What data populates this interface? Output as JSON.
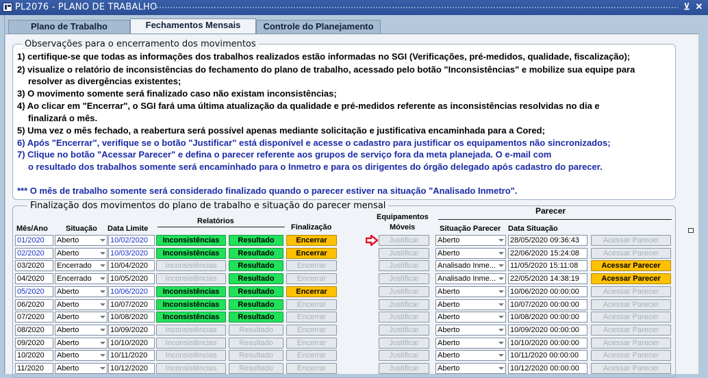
{
  "window": {
    "title": "PL2076 - PLANO DE TRABALHO",
    "restore_symbol": "⊻",
    "close_symbol": "✕"
  },
  "tabs": [
    {
      "label": "Plano de Trabalho",
      "active": false
    },
    {
      "label": "Fechamentos Mensais",
      "active": true
    },
    {
      "label": "Controle do Planejamento",
      "active": false
    }
  ],
  "observations": {
    "title": "Observações para o encerramento dos movimentos",
    "lines": [
      "1) certifique-se que todas as informações dos trabalhos realizados estão informadas no SGI (Verificações, pré-medidos, qualidade, fiscalização);",
      "2) visualize o relatório de inconsistências do fechamento do plano de trabalho, acessado pelo botão \"Inconsistências\" e mobilize sua equipe para",
      "    resolver as divergências existentes;",
      "3) O movimento somente será finalizado caso não existam inconsistências;",
      "4) Ao clicar em \"Encerrar\", o SGI fará uma última atualização da qualidade e pré-medidos referente as inconsistências resolvidas no dia e",
      "    finalizará o mês.",
      "5) Uma vez o mês fechado, a reabertura será possível apenas mediante solicitação e justificativa encaminhada para a Cored;"
    ],
    "blue_lines": [
      " 6) Após \"Encerrar\",  verifique se o botão \"Justificar\" está disponível e acesse o cadastro para justificar os equipamentos não sincronizados;",
      " 7) Clique no botão \"Acessar Parecer\" e defina o parecer referente aos grupos de serviço fora da meta planejada. O e-mail com",
      "     o resultado dos trabalhos somente será encaminhado para o Inmetro e para os dirigentes do órgão delegado após cadastro do parecer.",
      "*** O mês de trabalho somente será considerado finalizado quando o parecer estiver na situação \"Analisado Inmetro\"."
    ]
  },
  "section": {
    "title": "Finalização dos movimentos do plano de trabalho e situação do parecer mensal"
  },
  "headers": {
    "mes_ano": "Mês/Ano",
    "situacao": "Situação",
    "data_limite": "Data Limite",
    "relatorios": "Relatórios",
    "finalizacao": "Finalização",
    "equip_line1": "Equipamentos",
    "equip_line2": "Móveis",
    "parecer": "Parecer",
    "situacao_parecer": "Situação Parecer",
    "data_situacao": "Data Situação"
  },
  "rows": [
    {
      "mes": "01/2020",
      "situacao": "Aberto",
      "limite": "10/02/2020",
      "blue": true,
      "inconsist": "Inconsistências",
      "inc_on": true,
      "resultado": "Resultado",
      "res_on": true,
      "encerrar": "Encerrar",
      "enc_on": true,
      "justificar": "Justificar",
      "sit_parecer": "Aberto",
      "data_sit": "28/05/2020 09:36:43",
      "acessar": "Acessar Parecer",
      "acc_on": false
    },
    {
      "mes": "02/2020",
      "situacao": "Aberto",
      "limite": "10/03/2020",
      "blue": true,
      "inconsist": "Inconsistências",
      "inc_on": true,
      "resultado": "Resultado",
      "res_on": true,
      "encerrar": "Encerrar",
      "enc_on": true,
      "justificar": "Justificar",
      "sit_parecer": "Aberto",
      "data_sit": "22/06/2020 15:24:08",
      "acessar": "Acessar Parecer",
      "acc_on": false
    },
    {
      "mes": "03/2020",
      "situacao": "Encerrado",
      "limite": "10/04/2020",
      "blue": false,
      "inconsist": "Inconsistências",
      "inc_on": false,
      "resultado": "Resultado",
      "res_on": true,
      "encerrar": "Encerrar",
      "enc_on": false,
      "justificar": "Justificar",
      "sit_parecer": "Analisado Inme...",
      "data_sit": "11/05/2020 15:11:08",
      "acessar": "Acessar Parecer",
      "acc_on": true
    },
    {
      "mes": "04/2020",
      "situacao": "Encerrado",
      "limite": "10/05/2020",
      "blue": false,
      "inconsist": "Inconsistências",
      "inc_on": false,
      "resultado": "Resultado",
      "res_on": true,
      "encerrar": "Encerrar",
      "enc_on": false,
      "justificar": "Justificar",
      "sit_parecer": "Analisado Inme...",
      "data_sit": "22/05/2020 14:38:19",
      "acessar": "Acessar Parecer",
      "acc_on": true
    },
    {
      "mes": "05/2020",
      "situacao": "Aberto",
      "limite": "10/06/2020",
      "blue": true,
      "inconsist": "Inconsistências",
      "inc_on": true,
      "resultado": "Resultado",
      "res_on": true,
      "encerrar": "Encerrar",
      "enc_on": true,
      "justificar": "Justificar",
      "sit_parecer": "Aberto",
      "data_sit": "10/06/2020 00:00:00",
      "acessar": "Acessar Parecer",
      "acc_on": false
    },
    {
      "mes": "06/2020",
      "situacao": "Aberto",
      "limite": "10/07/2020",
      "blue": false,
      "inconsist": "Inconsistências",
      "inc_on": true,
      "resultado": "Resultado",
      "res_on": true,
      "encerrar": "Encerrar",
      "enc_on": false,
      "justificar": "Justificar",
      "sit_parecer": "Aberto",
      "data_sit": "10/07/2020 00:00:00",
      "acessar": "Acessar Parecer",
      "acc_on": false
    },
    {
      "mes": "07/2020",
      "situacao": "Aberto",
      "limite": "10/08/2020",
      "blue": false,
      "inconsist": "Inconsistências",
      "inc_on": true,
      "resultado": "Resultado",
      "res_on": true,
      "encerrar": "Encerrar",
      "enc_on": false,
      "justificar": "Justificar",
      "sit_parecer": "Aberto",
      "data_sit": "10/08/2020 00:00:00",
      "acessar": "Acessar Parecer",
      "acc_on": false
    },
    {
      "mes": "08/2020",
      "situacao": "Aberto",
      "limite": "10/09/2020",
      "blue": false,
      "inconsist": "Inconsistências",
      "inc_on": false,
      "resultado": "Resultado",
      "res_on": false,
      "encerrar": "Encerrar",
      "enc_on": false,
      "justificar": "Justificar",
      "sit_parecer": "Aberto",
      "data_sit": "10/09/2020 00:00:00",
      "acessar": "Acessar Parecer",
      "acc_on": false
    },
    {
      "mes": "09/2020",
      "situacao": "Aberto",
      "limite": "10/10/2020",
      "blue": false,
      "inconsist": "Inconsistências",
      "inc_on": false,
      "resultado": "Resultado",
      "res_on": false,
      "encerrar": "Encerrar",
      "enc_on": false,
      "justificar": "Justificar",
      "sit_parecer": "Aberto",
      "data_sit": "10/10/2020 00:00:00",
      "acessar": "Acessar Parecer",
      "acc_on": false
    },
    {
      "mes": "10/2020",
      "situacao": "Aberto",
      "limite": "10/11/2020",
      "blue": false,
      "inconsist": "Inconsistências",
      "inc_on": false,
      "resultado": "Resultado",
      "res_on": false,
      "encerrar": "Encerrar",
      "enc_on": false,
      "justificar": "Justificar",
      "sit_parecer": "Aberto",
      "data_sit": "10/11/2020 00:00:00",
      "acessar": "Acessar Parecer",
      "acc_on": false
    },
    {
      "mes": "11/2020",
      "situacao": "Aberto",
      "limite": "10/12/2020",
      "blue": false,
      "inconsist": "Inconsistências",
      "inc_on": false,
      "resultado": "Resultado",
      "res_on": false,
      "encerrar": "Encerrar",
      "enc_on": false,
      "justificar": "Justificar",
      "sit_parecer": "Aberto",
      "data_sit": "10/12/2020 00:00:00",
      "acessar": "Acessar Parecer",
      "acc_on": false
    }
  ],
  "colors": {
    "green_button": "#21e05a",
    "yellow_button": "#ffc000",
    "blue_text": "#1530c8",
    "arrow": "#e0102a"
  }
}
